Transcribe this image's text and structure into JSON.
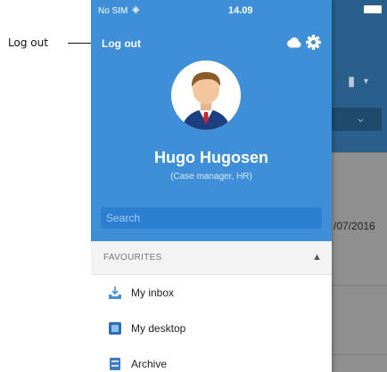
{
  "annotation": {
    "label": "Log out"
  },
  "statusbar": {
    "carrier": "No SIM",
    "wifi": "wifi-icon",
    "time": "14.09"
  },
  "header": {
    "logout_label": "Log out",
    "cloud": "cloud-icon",
    "settings": "gear-icon"
  },
  "profile": {
    "name": "Hugo Hugosen",
    "role": "(Case manager, HR)"
  },
  "search": {
    "placeholder": "Search"
  },
  "favourites": {
    "title": "FAVOURITES",
    "items": [
      {
        "label": "My inbox",
        "icon": "inbox-icon"
      },
      {
        "label": "My desktop",
        "icon": "desktop-icon"
      },
      {
        "label": "Archive",
        "icon": "archive-icon"
      }
    ]
  },
  "background": {
    "date_fragment": "/07/2016"
  },
  "colors": {
    "drawer_header": "#3f8fd8",
    "search_field": "#2b7fd0",
    "app_header": "#2a5f8c"
  }
}
